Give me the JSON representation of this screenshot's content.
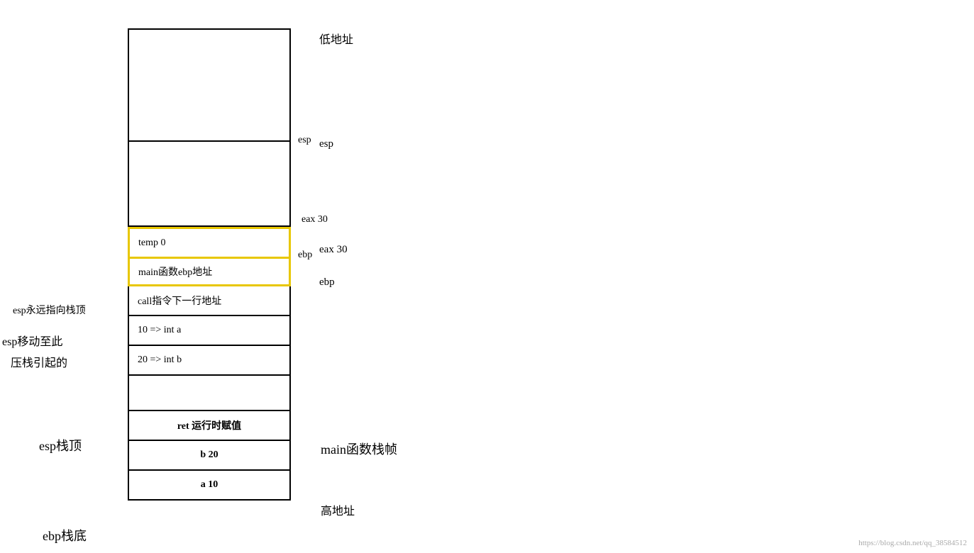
{
  "labels": {
    "low_address": "低地址",
    "high_address": "高地址",
    "esp_label": "esp",
    "ebp_label": "ebp",
    "eax_label": "eax 30",
    "esp_forever": "esp永远指向栈顶",
    "esp_moved": "esp移动至此",
    "esp_pushed": "压栈引起的",
    "esp_top": "esp栈顶",
    "ebp_bottom": "ebp栈底",
    "main_stack_frame": "main函数栈帧"
  },
  "cells": [
    {
      "id": "top-open",
      "type": "open",
      "height": 160
    },
    {
      "id": "empty-large",
      "type": "empty",
      "height": 120
    },
    {
      "id": "temp0",
      "type": "highlight-top",
      "text": "temp 0"
    },
    {
      "id": "main-ebp",
      "type": "highlight-bottom",
      "text": "main函数ebp地址"
    },
    {
      "id": "call-next",
      "type": "normal",
      "text": "call指令下一行地址"
    },
    {
      "id": "int-a",
      "type": "normal",
      "text": "10 => int a"
    },
    {
      "id": "int-b",
      "type": "normal",
      "text": "20 => int b"
    },
    {
      "id": "empty-medium",
      "type": "empty-medium"
    },
    {
      "id": "ret",
      "type": "center",
      "text": "ret  运行时赋值"
    },
    {
      "id": "b20",
      "type": "center",
      "text": "b    20"
    },
    {
      "id": "a10",
      "type": "center",
      "text": "a    10"
    }
  ],
  "watermark": "https://blog.csdn.net/qq_38584512"
}
